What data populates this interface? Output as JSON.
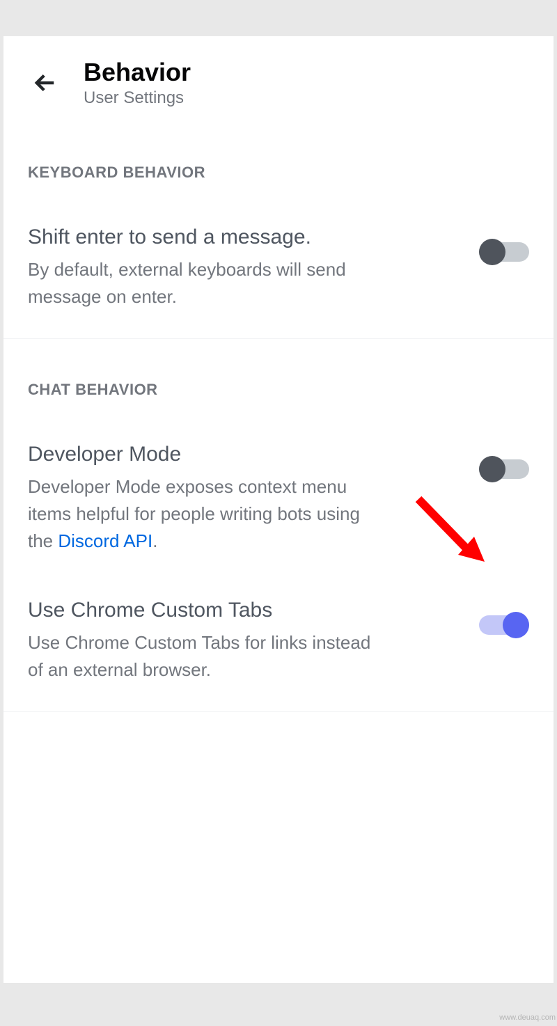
{
  "header": {
    "title": "Behavior",
    "subtitle": "User Settings"
  },
  "sections": {
    "keyboard": {
      "heading": "KEYBOARD BEHAVIOR",
      "items": {
        "shift_enter": {
          "title": "Shift enter to send a message.",
          "description": "By default, external keyboards will send message on enter.",
          "toggle_on": false
        }
      }
    },
    "chat": {
      "heading": "CHAT BEHAVIOR",
      "items": {
        "dev_mode": {
          "title": "Developer Mode",
          "description_pre": "Developer Mode exposes context menu items helpful for people writing bots using the ",
          "link_text": "Discord API",
          "description_post": ".",
          "toggle_on": false
        },
        "chrome_tabs": {
          "title": "Use Chrome Custom Tabs",
          "description": "Use Chrome Custom Tabs for links instead of an external browser.",
          "toggle_on": true
        }
      }
    }
  },
  "watermark": "www.deuaq.com"
}
